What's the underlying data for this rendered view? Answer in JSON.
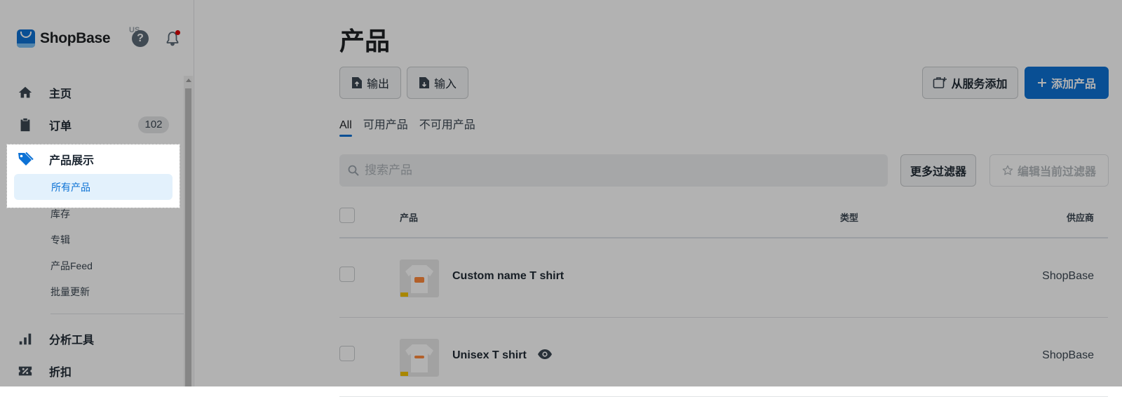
{
  "brand": {
    "name": "ShopBase",
    "region": "US"
  },
  "header": {
    "help_icon": "help-circle-icon",
    "notifications_icon": "bell-icon"
  },
  "sidebar": {
    "items": [
      {
        "label": "主页",
        "icon": "home-icon"
      },
      {
        "label": "订单",
        "icon": "clipboard-icon",
        "badge": "102"
      },
      {
        "label": "产品展示",
        "icon": "tag-icon"
      },
      {
        "label": "分析工具",
        "icon": "bar-chart-icon"
      },
      {
        "label": "折扣",
        "icon": "discount-icon"
      }
    ],
    "products_sub": [
      "所有产品",
      "库存",
      "专辑",
      "产品Feed",
      "批量更新"
    ],
    "active_sub": "所有产品"
  },
  "main": {
    "title": "产品",
    "export_label": "输出",
    "import_label": "输入",
    "add_from_service_label": "从服务添加",
    "add_product_label": "添加产品",
    "tabs": [
      "All",
      "可用产品",
      "不可用产品"
    ],
    "search_placeholder": "搜索产品",
    "more_filters_label": "更多过滤器",
    "edit_filter_label": "编辑当前过滤器",
    "columns": {
      "product": "产品",
      "type": "类型",
      "vendor": "供应商"
    },
    "rows": [
      {
        "name": "Custom name T shirt",
        "vendor": "ShopBase",
        "visibility_icon": ""
      },
      {
        "name": "Unisex T shirt",
        "vendor": "ShopBase",
        "visibility_icon": "eye-icon"
      }
    ]
  },
  "colors": {
    "accent": "#0d72d5",
    "badge_bg": "#e4e5e7",
    "notification_dot": "#e00000"
  }
}
